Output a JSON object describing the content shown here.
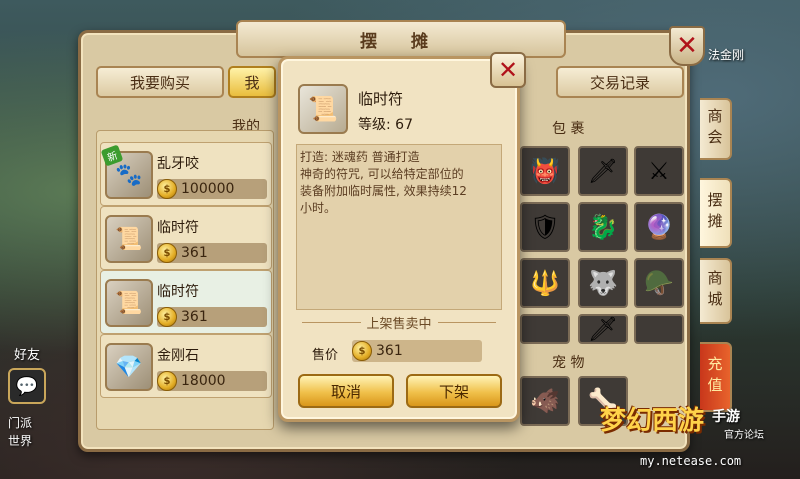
{
  "window": {
    "title": "摆 摊"
  },
  "tabs": {
    "buy": "我要购买",
    "sell_partial": "我",
    "log": "交易记录"
  },
  "left_section_title": "我的",
  "bag_title": "包 裹",
  "pet_title": "宠 物",
  "stall_items": [
    {
      "name": "乱牙咬",
      "price": "100000",
      "icon": "pet-egg-icon",
      "badge": "新"
    },
    {
      "name": "临时符",
      "price": "361",
      "icon": "talisman-icon",
      "badge": ""
    },
    {
      "name": "临时符",
      "price": "361",
      "icon": "talisman-icon",
      "badge": ""
    },
    {
      "name": "金刚石",
      "price": "18000",
      "icon": "diamond-stone-icon",
      "badge": ""
    }
  ],
  "side_tabs": [
    "商会",
    "摆摊",
    "商城",
    "充值"
  ],
  "hud": {
    "friends": "好友",
    "chat_icon": "chat-icon",
    "left_hints": [
      "门派",
      "世界"
    ],
    "top_right_hint": "法金刚"
  },
  "popup": {
    "item_name": "临时符",
    "level_label": "等级:",
    "level_value": "67",
    "desc_lines": [
      "打造: 迷魂药   普通打造",
      "神奇的符咒, 可以给特定部位的",
      "装备附加临时属性, 效果持续12",
      "小时。"
    ],
    "status": "上架售卖中",
    "price_label": "售价",
    "price": "361",
    "cancel_label": "取消",
    "delist_label": "下架"
  },
  "branding": {
    "logo": "梦幻西游",
    "sub": "手游",
    "sub2": "官方论坛",
    "url": "my.netease.com"
  },
  "colors": {
    "panel": "#d9c9a3",
    "gold_button": "#f0c04a",
    "close_red": "#b0121a"
  }
}
